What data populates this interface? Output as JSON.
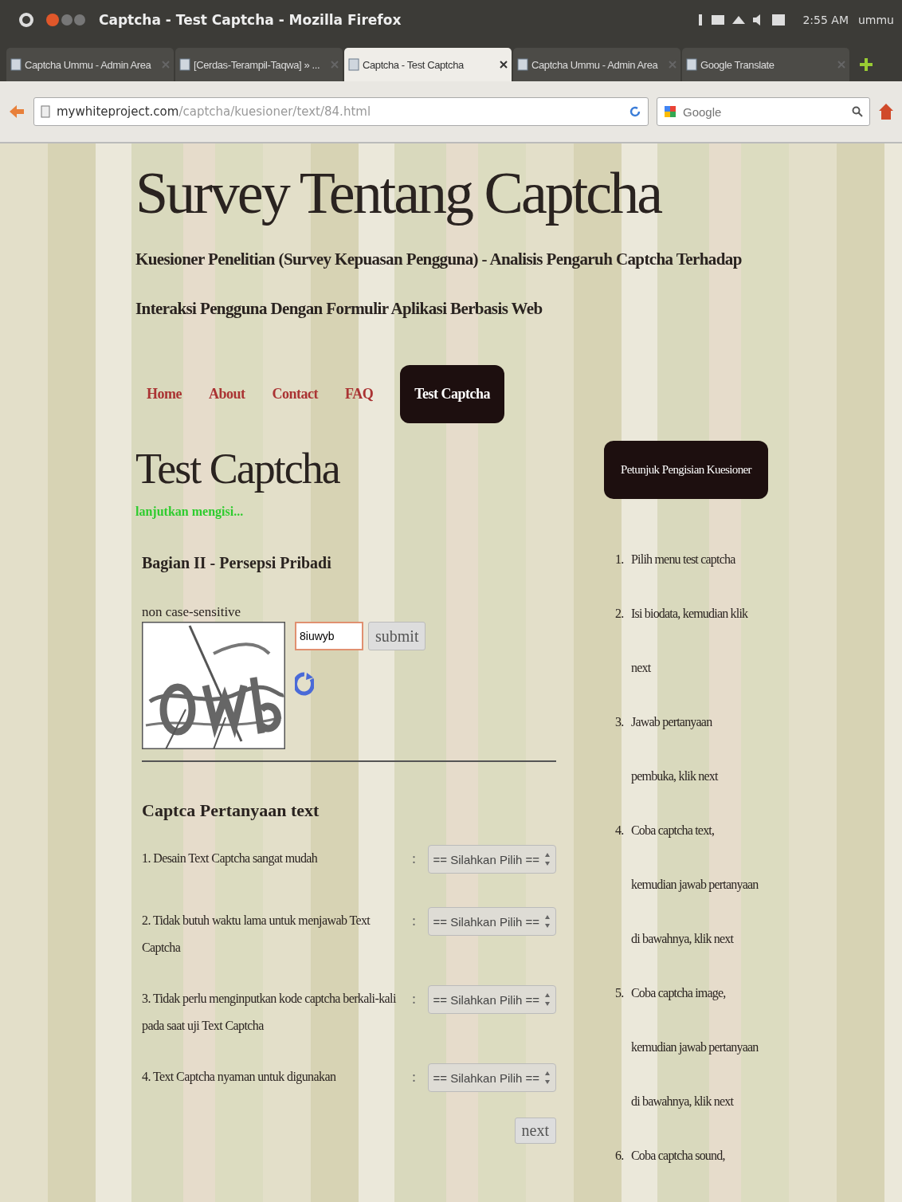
{
  "window": {
    "title": "Captcha - Test Captcha - Mozilla Firefox",
    "clock": "2:55 AM",
    "user": "ummu"
  },
  "tabs": [
    {
      "label": "Captcha Ummu - Admin Area",
      "selected": false
    },
    {
      "label": "[Cerdas-Terampil-Taqwa] » ...",
      "selected": false
    },
    {
      "label": "Captcha - Test Captcha",
      "selected": true
    },
    {
      "label": "Captcha Ummu - Admin Area",
      "selected": false
    },
    {
      "label": "Google Translate",
      "selected": false
    }
  ],
  "address_bar": {
    "host": "mywhiteproject.com",
    "path": "/captcha/kuesioner/text/84.html"
  },
  "search": {
    "placeholder": "Google"
  },
  "site": {
    "title": "Survey Tentang Captcha",
    "subtitle": "Kuesioner Penelitian (Survey Kepuasan Pengguna) - Analisis Pengaruh Captcha Terhadap Interaksi Pengguna Dengan Formulir Aplikasi Berbasis Web"
  },
  "nav": [
    {
      "label": "Home",
      "selected": false
    },
    {
      "label": "About",
      "selected": false
    },
    {
      "label": "Contact",
      "selected": false
    },
    {
      "label": "FAQ",
      "selected": false
    },
    {
      "label": "Test Captcha",
      "selected": true
    }
  ],
  "page": {
    "heading": "Test Captcha",
    "notice": "lanjutkan mengisi...",
    "section": "Bagian II - Persepsi Pribadi",
    "captcha_hint": "non case-sensitive",
    "captcha_value": "8iuwyb",
    "submit": "submit"
  },
  "questions": {
    "heading": "Captca Pertanyaan text",
    "items": [
      {
        "text": "1. Desain Text Captcha sangat mudah",
        "separator": ":",
        "value": "== Silahkan Pilih =="
      },
      {
        "text": "2. Tidak butuh waktu lama untuk menjawab Text Captcha",
        "separator": ":",
        "value": "== Silahkan Pilih =="
      },
      {
        "text": "3. Tidak perlu menginputkan kode captcha berkali-kali pada saat uji Text Captcha",
        "separator": ":",
        "value": "== Silahkan Pilih =="
      },
      {
        "text": "4. Text Captcha nyaman untuk digunakan",
        "separator": ":",
        "value": "== Silahkan Pilih =="
      }
    ],
    "next": "next"
  },
  "sidebar": {
    "title": "Petunjuk Pengisian Kuesioner",
    "steps": [
      {
        "number": "1.",
        "text": "Pilih menu test captcha"
      },
      {
        "number": "2.",
        "text": "Isi biodata, kemudian klik next"
      },
      {
        "number": "3.",
        "text": "Jawab pertanyaan pembuka, klik next"
      },
      {
        "number": "4.",
        "text": "Coba captcha text, kemudian jawab pertanyaan di bawahnya, klik next"
      },
      {
        "number": "5.",
        "text": "Coba captcha image, kemudian jawab pertanyaan di bawahnya, klik next"
      },
      {
        "number": "6.",
        "text": "Coba captcha sound,"
      }
    ]
  }
}
